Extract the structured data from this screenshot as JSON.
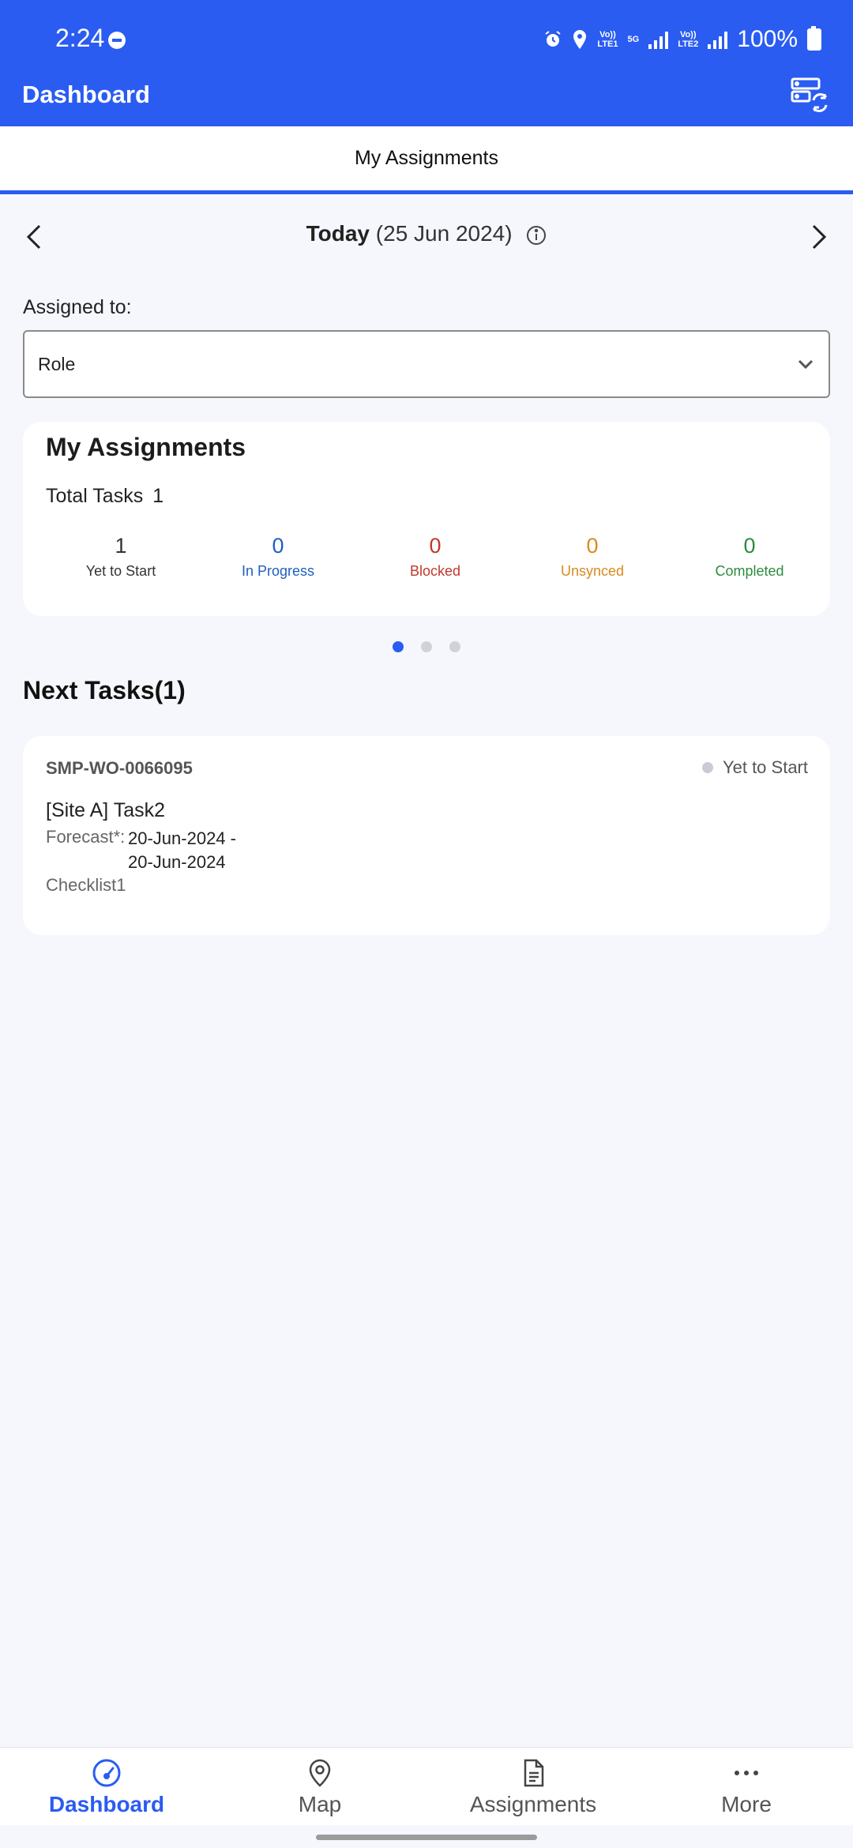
{
  "status_bar": {
    "time": "2:24",
    "battery": "100%",
    "net1": "Vo))\nLTE1",
    "net2": "Vo))\nLTE2",
    "five_g": "5G"
  },
  "app_bar": {
    "title": "Dashboard"
  },
  "tabs": [
    {
      "label": "My Assignments",
      "active": true
    }
  ],
  "date_nav": {
    "day": "Today",
    "date": "(25 Jun 2024)"
  },
  "assigned_to": {
    "label": "Assigned to:",
    "value": "Role"
  },
  "summary": {
    "title": "My Assignments",
    "total_label": "Total Tasks",
    "total_value": "1",
    "stats": [
      {
        "value": "1",
        "label": "Yet to Start",
        "color": "#333333"
      },
      {
        "value": "0",
        "label": "In Progress",
        "color": "#1f5fbf"
      },
      {
        "value": "0",
        "label": "Blocked",
        "color": "#c0392b"
      },
      {
        "value": "0",
        "label": "Unsynced",
        "color": "#d98a1c"
      },
      {
        "value": "0",
        "label": "Completed",
        "color": "#2e8b3d"
      }
    ]
  },
  "pager": {
    "pages": 3,
    "active": 0
  },
  "next_tasks": {
    "heading": "Next Tasks(1)",
    "items": [
      {
        "id": "SMP-WO-0066095",
        "status": "Yet to Start",
        "name": "[Site A] Task2",
        "forecast_label": "Forecast*:",
        "forecast_start": "20-Jun-2024 -",
        "forecast_end": "20-Jun-2024",
        "checklist": "Checklist1"
      }
    ]
  },
  "bottom_nav": [
    {
      "label": "Dashboard",
      "icon": "gauge-icon",
      "active": true
    },
    {
      "label": "Map",
      "icon": "map-pin-icon",
      "active": false
    },
    {
      "label": "Assignments",
      "icon": "document-icon",
      "active": false
    },
    {
      "label": "More",
      "icon": "more-icon",
      "active": false
    }
  ],
  "colors": {
    "primary": "#2a5cf2",
    "background": "#f5f7fc"
  }
}
